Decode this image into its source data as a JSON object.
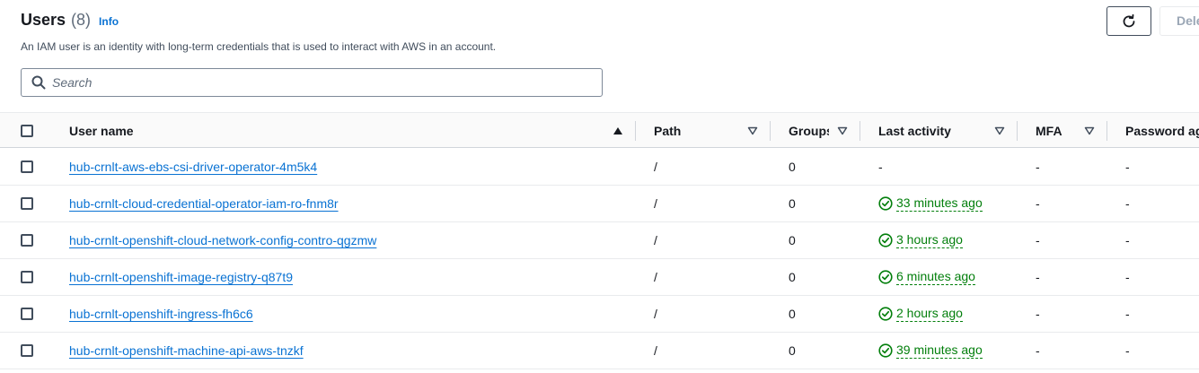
{
  "header": {
    "title": "Users",
    "count": "(8)",
    "info": "Info",
    "description": "An IAM user is an identity with long-term credentials that is used to interact with AWS in an account.",
    "delete_label": "Delete"
  },
  "search": {
    "placeholder": "Search",
    "value": ""
  },
  "table": {
    "columns": {
      "user_name": "User name",
      "path": "Path",
      "groups": "Groups",
      "last_activity": "Last activity",
      "mfa": "MFA",
      "password_age": "Password age"
    },
    "sort": {
      "column": "User name",
      "direction": "ascending"
    },
    "rows": [
      {
        "user_name": "hub-crnlt-aws-ebs-csi-driver-operator-4m5k4",
        "path": "/",
        "groups": "0",
        "last_activity": "-",
        "active": false,
        "mfa": "-",
        "password_age": "-"
      },
      {
        "user_name": "hub-crnlt-cloud-credential-operator-iam-ro-fnm8r",
        "path": "/",
        "groups": "0",
        "last_activity": "33 minutes ago",
        "active": true,
        "mfa": "-",
        "password_age": "-"
      },
      {
        "user_name": "hub-crnlt-openshift-cloud-network-config-contro-qgzmw",
        "path": "/",
        "groups": "0",
        "last_activity": "3 hours ago",
        "active": true,
        "mfa": "-",
        "password_age": "-"
      },
      {
        "user_name": "hub-crnlt-openshift-image-registry-q87t9",
        "path": "/",
        "groups": "0",
        "last_activity": "6 minutes ago",
        "active": true,
        "mfa": "-",
        "password_age": "-"
      },
      {
        "user_name": "hub-crnlt-openshift-ingress-fh6c6",
        "path": "/",
        "groups": "0",
        "last_activity": "2 hours ago",
        "active": true,
        "mfa": "-",
        "password_age": "-"
      },
      {
        "user_name": "hub-crnlt-openshift-machine-api-aws-tnzkf",
        "path": "/",
        "groups": "0",
        "last_activity": "39 minutes ago",
        "active": true,
        "mfa": "-",
        "password_age": "-"
      }
    ]
  },
  "icons": {
    "search": "search-icon",
    "refresh": "refresh-icon",
    "sort_ascending": "caret-up-filled-icon",
    "sort_unsorted": "caret-down-outline-icon",
    "status_success": "status-positive-icon"
  },
  "colors": {
    "link": "#0972d3",
    "success": "#037f0c",
    "text": "#16191f",
    "muted": "#5f6b7a"
  }
}
